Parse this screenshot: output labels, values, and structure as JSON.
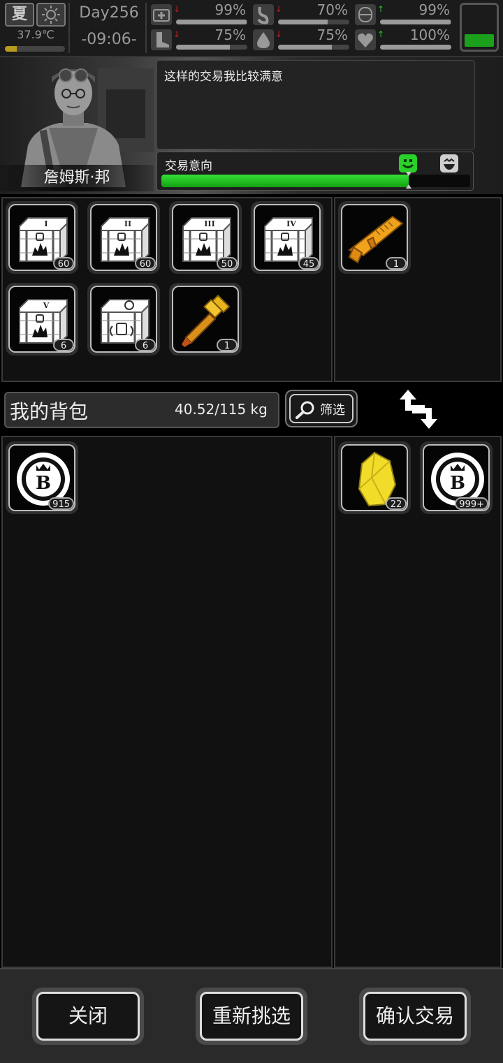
{
  "status": {
    "season": "夏",
    "temperature": "37.9℃",
    "temperature_level": 0.2,
    "day": "Day256",
    "time": "-09:06-",
    "stats": [
      {
        "name": "health",
        "icon": "medkit-icon",
        "trend": "down",
        "value": "99%",
        "level": 0.99
      },
      {
        "name": "hunger",
        "icon": "stomach-icon",
        "trend": "down",
        "value": "70%",
        "level": 0.7
      },
      {
        "name": "mood",
        "icon": "brain-icon",
        "trend": "up",
        "value": "99%",
        "level": 0.99
      },
      {
        "name": "stamina",
        "icon": "boot-icon",
        "trend": "down",
        "value": "75%",
        "level": 0.75
      },
      {
        "name": "thirst",
        "icon": "water-drop-icon",
        "trend": "down",
        "value": "75%",
        "level": 0.75
      },
      {
        "name": "heart",
        "icon": "heart-icon",
        "trend": "up",
        "value": "100%",
        "level": 1.0
      }
    ],
    "battery_level": 0.3
  },
  "npc": {
    "name": "詹姆斯·邦",
    "dialog": "这样的交易我比较满意",
    "intent_label": "交易意向",
    "intent_level": 0.8
  },
  "npc_items": [
    {
      "icon": "crate-tier-1-icon",
      "roman": "I",
      "qty": "60"
    },
    {
      "icon": "crate-tier-2-icon",
      "roman": "II",
      "qty": "60"
    },
    {
      "icon": "crate-tier-3-icon",
      "roman": "III",
      "qty": "50"
    },
    {
      "icon": "crate-tier-4-icon",
      "roman": "IV",
      "qty": "45"
    },
    {
      "icon": "crate-tier-5-icon",
      "roman": "V",
      "qty": "6"
    },
    {
      "icon": "crate-special-icon",
      "roman": "",
      "qty": "6"
    },
    {
      "icon": "golden-hammer-icon",
      "roman": "",
      "qty": "1"
    }
  ],
  "npc_offer": [
    {
      "icon": "golden-rifle-icon",
      "qty": "1"
    }
  ],
  "backpack": {
    "title": "我的背包",
    "weight": "40.52/115 kg",
    "filter_label": "筛选"
  },
  "my_items": [
    {
      "icon": "bitcoin-coin-icon",
      "qty": "915"
    }
  ],
  "my_offer": [
    {
      "icon": "gold-crystal-icon",
      "qty": "22"
    },
    {
      "icon": "bitcoin-coin-icon",
      "qty": "999+"
    }
  ],
  "buttons": {
    "close": "关闭",
    "reselect": "重新挑选",
    "confirm": "确认交易"
  },
  "colors": {
    "accent_green": "#1aa01a",
    "gold": "#e8a21c"
  }
}
